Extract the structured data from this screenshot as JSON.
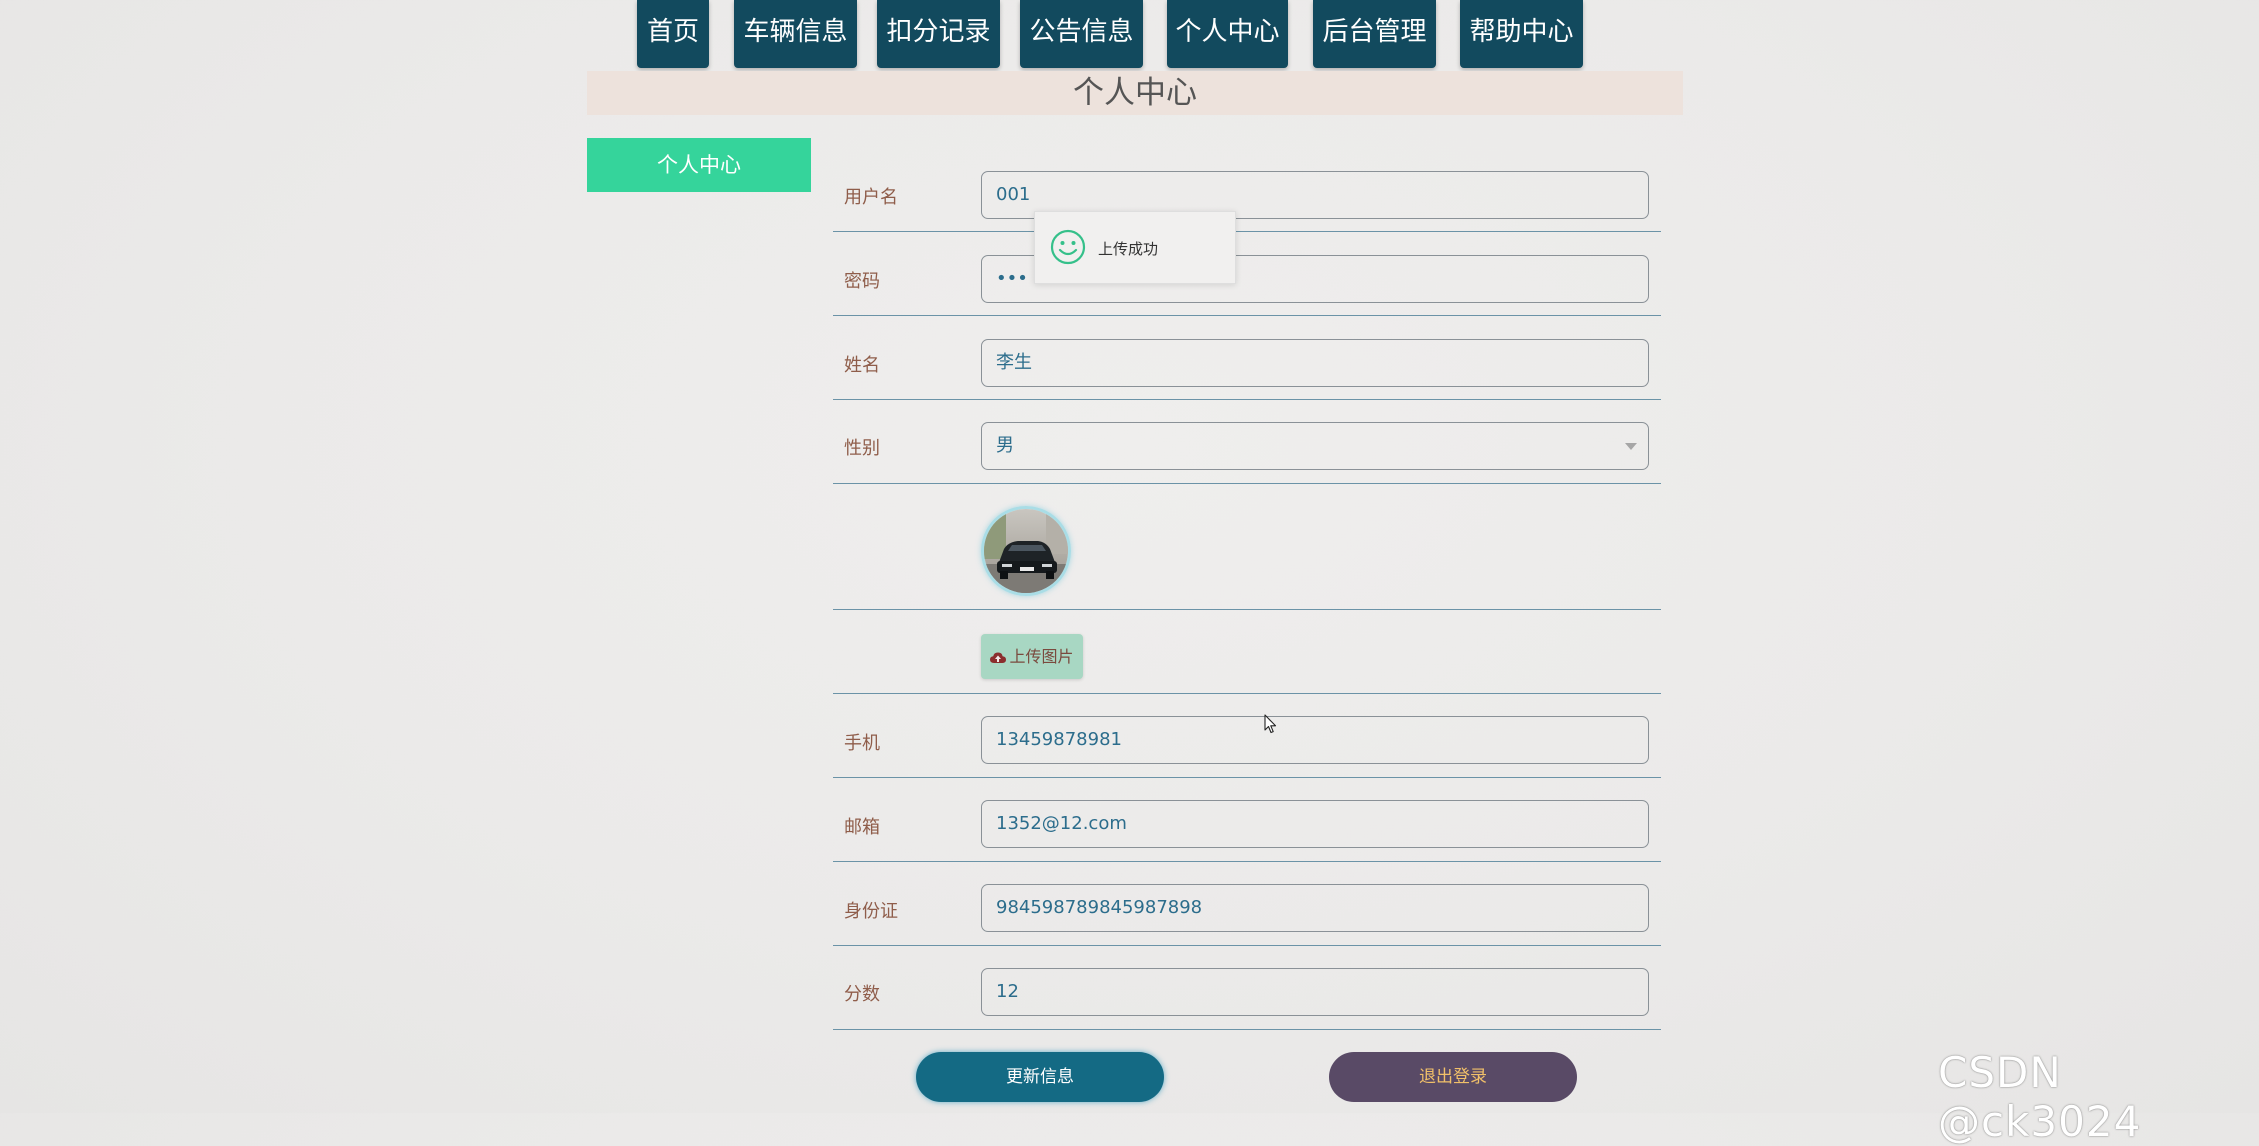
{
  "nav": {
    "items": [
      {
        "label": "首页"
      },
      {
        "label": "车辆信息"
      },
      {
        "label": "扣分记录"
      },
      {
        "label": "公告信息"
      },
      {
        "label": "个人中心"
      },
      {
        "label": "后台管理"
      },
      {
        "label": "帮助中心"
      }
    ]
  },
  "page_title": "个人中心",
  "sidebar": {
    "items": [
      {
        "label": "个人中心",
        "active": true
      }
    ]
  },
  "form": {
    "username": {
      "label": "用户名",
      "value": "001"
    },
    "password": {
      "label": "密码",
      "value": "•••"
    },
    "name": {
      "label": "姓名",
      "value": "李生"
    },
    "gender": {
      "label": "性别",
      "value": "男"
    },
    "upload_button": "上传图片",
    "phone": {
      "label": "手机",
      "value": "13459878981"
    },
    "email": {
      "label": "邮箱",
      "value": "1352@12.com"
    },
    "id_card": {
      "label": "身份证",
      "value": "984598789845987898"
    },
    "score": {
      "label": "分数",
      "value": "12"
    }
  },
  "toast": {
    "message": "上传成功",
    "icon": "smile-icon"
  },
  "buttons": {
    "update": "更新信息",
    "logout": "退出登录"
  },
  "watermark": "CSDN @ck3024",
  "colors": {
    "nav_bg": "#124a5e",
    "sidebar_active": "#35d49b",
    "title_bar": "#ede2dc",
    "update_button": "#146a84",
    "logout_button": "#594a66",
    "upload_button": "#a8d7c3"
  }
}
